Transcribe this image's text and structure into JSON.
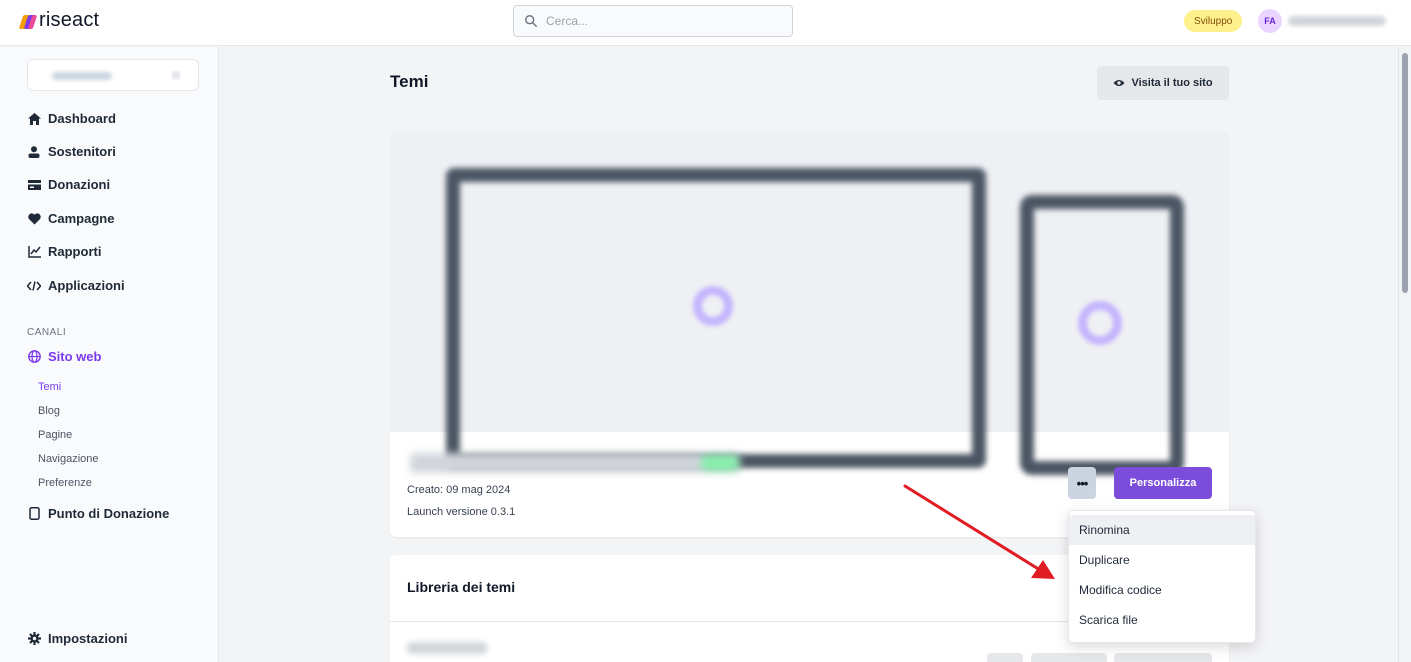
{
  "app": {
    "logo_text": "riseact",
    "env_badge": "Sviluppo",
    "avatar_initials": "FA"
  },
  "search": {
    "placeholder": "Cerca..."
  },
  "sidebar": {
    "items": [
      {
        "label": "Dashboard",
        "icon": "home-icon"
      },
      {
        "label": "Sostenitori",
        "icon": "user-icon"
      },
      {
        "label": "Donazioni",
        "icon": "credit-card-icon"
      },
      {
        "label": "Campagne",
        "icon": "heart-icon"
      },
      {
        "label": "Rapporti",
        "icon": "chart-icon"
      },
      {
        "label": "Applicazioni",
        "icon": "code-icon"
      }
    ],
    "channels_label": "CANALI",
    "website": {
      "label": "Sito web",
      "icon": "globe-icon",
      "subitems": [
        "Temi",
        "Blog",
        "Pagine",
        "Navigazione",
        "Preferenze"
      ]
    },
    "donation_point": {
      "label": "Punto di Donazione",
      "icon": "tablet-icon"
    },
    "settings": {
      "label": "Impostazioni",
      "icon": "gear-icon"
    }
  },
  "main": {
    "title": "Temi",
    "visit_button": "Visita il tuo sito",
    "current_theme": {
      "created": "Creato: 09 mag 2024",
      "version": "Launch versione 0.3.1",
      "more_button": "•••",
      "customize_button": "Personalizza"
    },
    "library_title": "Libreria dei temi"
  },
  "dropdown": {
    "items": [
      "Rinomina",
      "Duplicare",
      "Modifica codice",
      "Scarica file"
    ],
    "highlighted_index": 0
  },
  "colors": {
    "accent": "#7c4ddb",
    "annotation_arrow": "#e11d24"
  }
}
